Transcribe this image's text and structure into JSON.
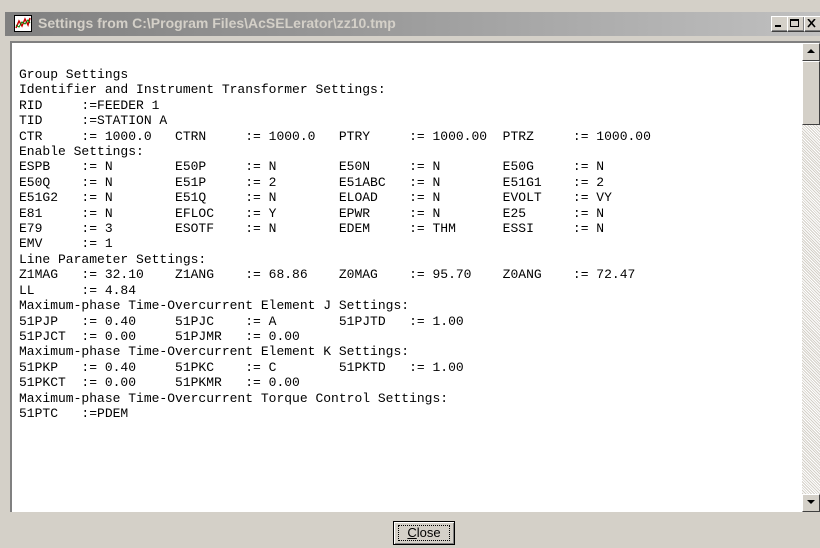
{
  "window": {
    "title": "Settings from C:\\Program Files\\AcSELerator\\zz10.tmp"
  },
  "settings_lines": [
    "Group Settings",
    "Identifier and Instrument Transformer Settings:",
    "RID     :=FEEDER 1",
    "TID     :=STATION A",
    "CTR     := 1000.0   CTRN     := 1000.0   PTRY     := 1000.00  PTRZ     := 1000.00",
    "Enable Settings:",
    "ESPB    := N        E50P     := N        E50N     := N        E50G     := N",
    "E50Q    := N        E51P     := 2        E51ABC   := N        E51G1    := 2",
    "E51G2   := N        E51Q     := N        ELOAD    := N        EVOLT    := VY",
    "E81     := N        EFLOC    := Y        EPWR     := N        E25      := N",
    "E79     := 3        ESOTF    := N        EDEM     := THM      ESSI     := N",
    "EMV     := 1",
    "Line Parameter Settings:",
    "Z1MAG   := 32.10    Z1ANG    := 68.86    Z0MAG    := 95.70    Z0ANG    := 72.47",
    "LL      := 4.84",
    "Maximum-phase Time-Overcurrent Element J Settings:",
    "51PJP   := 0.40     51PJC    := A        51PJTD   := 1.00",
    "51PJCT  := 0.00     51PJMR   := 0.00",
    "Maximum-phase Time-Overcurrent Element K Settings:",
    "51PKP   := 0.40     51PKC    := C        51PKTD   := 1.00",
    "51PKCT  := 0.00     51PKMR   := 0.00",
    "Maximum-phase Time-Overcurrent Torque Control Settings:",
    "51PTC   :=PDEM"
  ],
  "buttons": {
    "close_prefix": "",
    "close_accel": "C",
    "close_rest": "lose"
  },
  "icons": {
    "title": "settings-chart-icon",
    "minimize": "minimize-icon",
    "maximize": "maximize-icon",
    "close": "close-icon",
    "scroll_up": "scroll-up-arrow-icon",
    "scroll_down": "scroll-down-arrow-icon"
  }
}
